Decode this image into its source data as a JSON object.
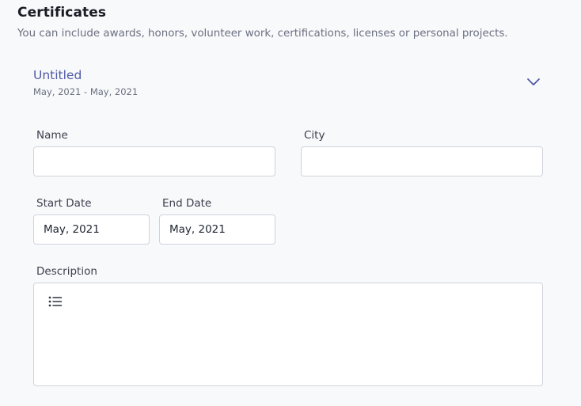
{
  "section": {
    "title": "Certificates",
    "subtitle": "You can include awards, honors, volunteer work, certifications, licenses or personal projects."
  },
  "entry": {
    "title": "Untitled",
    "dates": "May, 2021 - May, 2021",
    "chevron_icon": "chevron-down-icon"
  },
  "form": {
    "name_label": "Name",
    "name_value": "",
    "city_label": "City",
    "city_value": "",
    "start_date_label": "Start Date",
    "start_date_value": "May, 2021",
    "end_date_label": "End Date",
    "end_date_value": "May, 2021",
    "description_label": "Description",
    "description_toolbar_icon": "bulleted-list-icon"
  },
  "colors": {
    "accent": "#4f5aa6",
    "border": "#cfd3dc",
    "background": "#f8f9fb"
  }
}
